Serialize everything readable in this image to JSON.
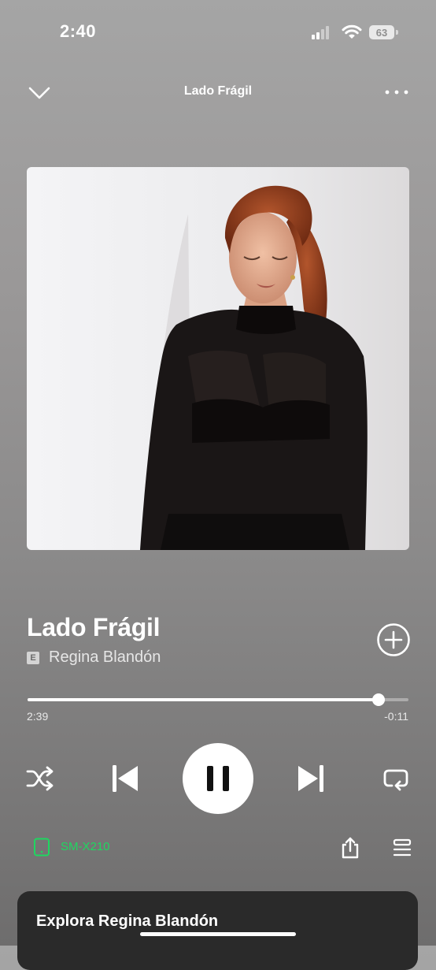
{
  "status_bar": {
    "time": "2:40",
    "battery_level": "63"
  },
  "header": {
    "title": "Lado Frágil"
  },
  "track": {
    "title": "Lado Frágil",
    "explicit_badge": "E",
    "artist": "Regina Blandón"
  },
  "progress": {
    "elapsed": "2:39",
    "remaining": "-0:11",
    "fraction": 0.921
  },
  "device": {
    "name": "SM-X210"
  },
  "explore": {
    "title": "Explora Regina Blandón"
  },
  "colors": {
    "accent_green": "#1ed760",
    "background_top": "#a5a5a5",
    "background_bottom": "#6e6d6d",
    "card": "#2a2a2a"
  },
  "icons": [
    "signal-icon",
    "wifi-icon",
    "battery-icon",
    "chevron-down-icon",
    "more-icon",
    "plus-circle-icon",
    "shuffle-icon",
    "skip-previous-icon",
    "pause-icon",
    "skip-next-icon",
    "repeat-icon",
    "tablet-device-icon",
    "share-icon",
    "queue-icon"
  ]
}
